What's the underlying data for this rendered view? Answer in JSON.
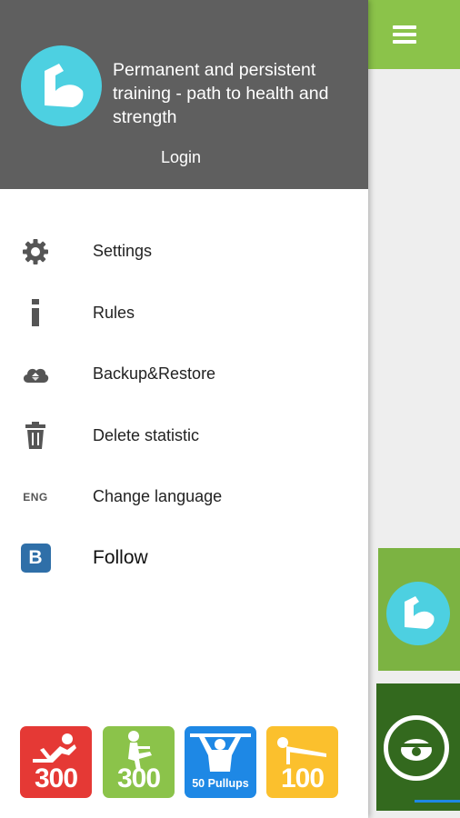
{
  "drawer": {
    "tagline": "Permanent and persistent training - path to health and strength",
    "login_label": "Login",
    "menu_items": [
      {
        "label": "Settings",
        "icon": "gear-icon"
      },
      {
        "label": "Rules",
        "icon": "info-icon"
      },
      {
        "label": "Backup&Restore",
        "icon": "cloud-sync-icon"
      },
      {
        "label": "Delete statistic",
        "icon": "trash-icon"
      },
      {
        "label": "Change language",
        "icon": "language-icon",
        "icon_text": "ENG"
      },
      {
        "label": "Follow",
        "icon": "vk-icon",
        "icon_text": "B"
      }
    ]
  },
  "apps": [
    {
      "label": "300",
      "color": "#e53935",
      "icon": "situp-icon"
    },
    {
      "label": "300",
      "color": "#8bc34a",
      "icon": "squat-icon"
    },
    {
      "label": "50 Pullups",
      "color": "#1e88e5",
      "icon": "pullup-icon"
    },
    {
      "label": "100",
      "color": "#fbc02d",
      "icon": "pushup-icon"
    }
  ],
  "colors": {
    "header_bg": "#5f5f5f",
    "accent_green": "#8bc34a",
    "avatar_cyan": "#4dd0e1"
  }
}
